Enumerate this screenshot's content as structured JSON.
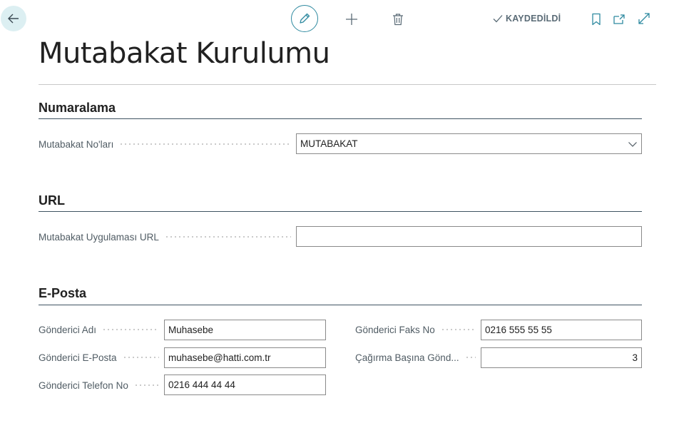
{
  "toolbar": {
    "saved_label": "KAYDEDİLDİ"
  },
  "page": {
    "title": "Mutabakat Kurulumu"
  },
  "sections": {
    "numbering": {
      "title": "Numaralama",
      "fields": {
        "nos": {
          "label": "Mutabakat No'ları",
          "value": "MUTABAKAT"
        }
      }
    },
    "url": {
      "title": "URL",
      "fields": {
        "app_url": {
          "label": "Mutabakat Uygulaması URL",
          "value": ""
        }
      }
    },
    "email": {
      "title": "E-Posta",
      "fields": {
        "sender_name": {
          "label": "Gönderici Adı",
          "value": "Muhasebe"
        },
        "sender_email": {
          "label": "Gönderici E-Posta",
          "value": "muhasebe@hatti.com.tr"
        },
        "sender_phone": {
          "label": "Gönderici Telefon No",
          "value": "0216 444 44 44"
        },
        "sender_fax": {
          "label": "Gönderici Faks No",
          "value": "0216 555 55 55"
        },
        "per_call": {
          "label": "Çağırma Başına Gönd...",
          "value": "3"
        }
      }
    }
  },
  "colors": {
    "accent": "#2f8aa0",
    "back_bg": "#dceff2",
    "section_line": "#3f5362"
  },
  "icons": [
    "back-arrow-icon",
    "pencil-icon",
    "plus-icon",
    "trash-icon",
    "check-icon",
    "bookmark-icon",
    "open-new-window-icon",
    "expand-icon",
    "chevron-down-icon"
  ]
}
